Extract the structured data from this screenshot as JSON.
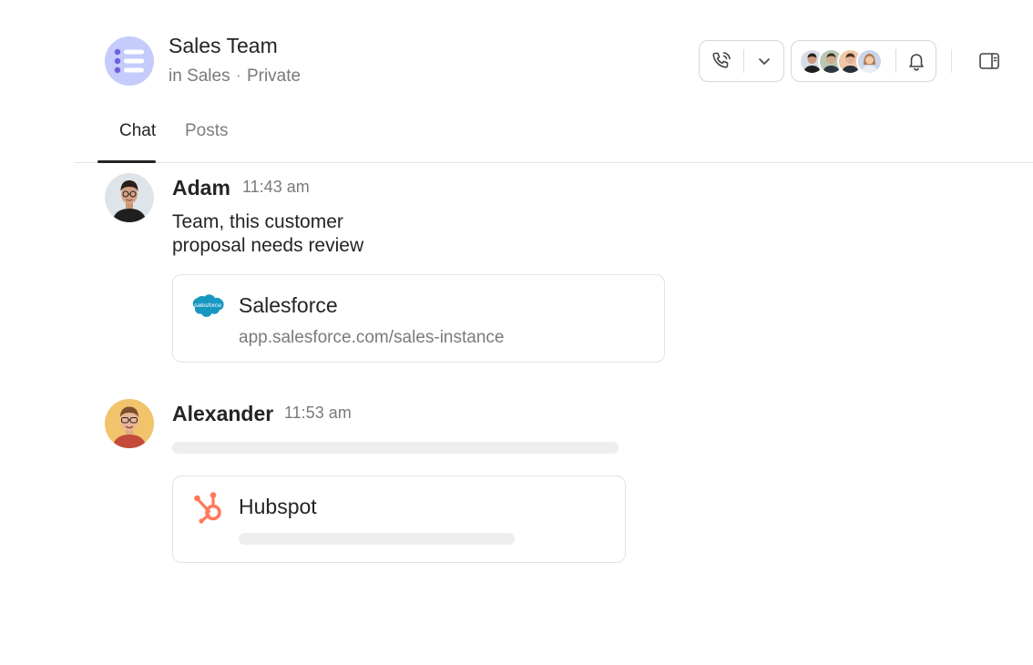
{
  "channel": {
    "title": "Sales Team",
    "team": "in Sales",
    "separator": "·",
    "privacy": "Private",
    "icon": "list-icon",
    "icon_bg": "#c5cbfa",
    "icon_fg": "#6b5fe0"
  },
  "toolbar": {
    "call_icon": "phone-icon",
    "dropdown_icon": "chevron-down-icon",
    "notification_icon": "bell-icon",
    "panel_icon": "side-panel-icon",
    "member_avatar_count": 4
  },
  "tabs": [
    {
      "label": "Chat",
      "selected": true
    },
    {
      "label": "Posts",
      "selected": false
    }
  ],
  "messages": [
    {
      "author": "Adam",
      "time": "11:43 am",
      "text_lines": [
        "Team, this customer",
        "proposal needs review"
      ],
      "card": {
        "title": "Salesforce",
        "url": "app.salesforce.com/sales-instance",
        "logo_text": "salesforce",
        "logo_color": "#1798c1"
      }
    },
    {
      "author": "Alexander",
      "time": "11:53 am",
      "card": {
        "title": "Hubspot",
        "logo_color": "#ff7a59"
      }
    }
  ],
  "colors": {
    "text": "#242424",
    "muted": "#7a7a7a",
    "border": "#e2e2e2",
    "skeleton": "#eeeeee"
  }
}
